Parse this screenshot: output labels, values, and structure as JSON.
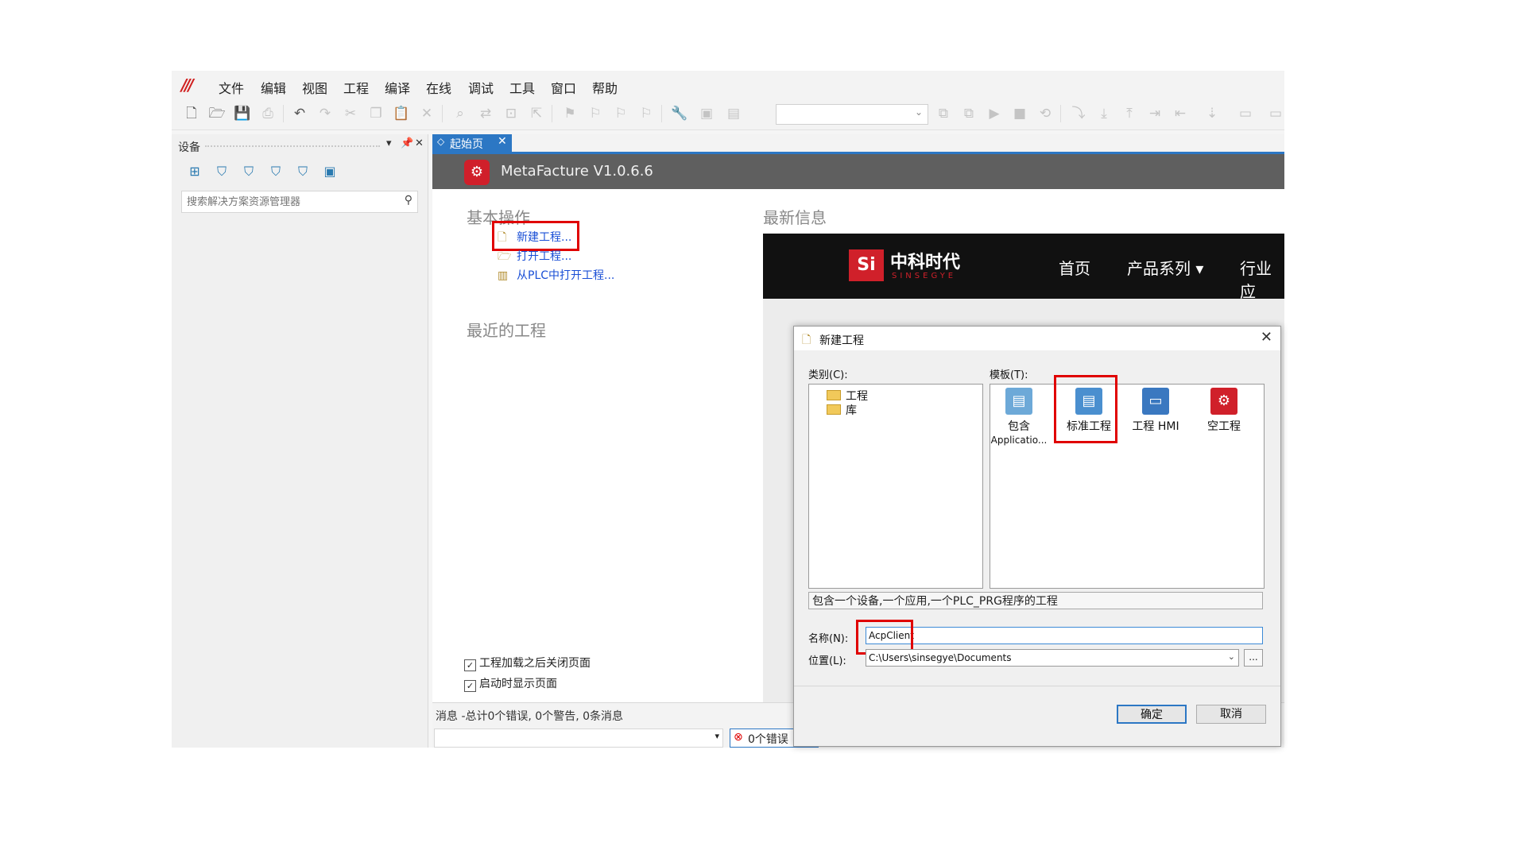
{
  "menubar": {
    "logo": "///",
    "items": [
      "文件",
      "编辑",
      "视图",
      "工程",
      "编译",
      "在线",
      "调试",
      "工具",
      "窗口",
      "帮助"
    ]
  },
  "toolbar": {
    "icons": [
      "new-file-icon",
      "open-folder-icon",
      "save-icon",
      "print-icon",
      "undo-icon",
      "redo-icon",
      "cut-icon",
      "copy-icon",
      "paste-icon",
      "delete-icon"
    ]
  },
  "left_panel": {
    "title": "设备",
    "search_placeholder": "搜索解决方案资源管理器"
  },
  "tabs": [
    {
      "label": "起始页"
    }
  ],
  "banner": {
    "title": "MetaFacture V1.0.6.6"
  },
  "basic_ops": {
    "heading": "基本操作",
    "new_project": "新建工程...",
    "open_project": "打开工程...",
    "open_from_plc": "从PLC中打开工程..."
  },
  "recent": {
    "heading": "最近的工程"
  },
  "news": {
    "heading": "最新信息",
    "brand": "中科时代",
    "brand_sub": "SINSEGYE",
    "nav": [
      "首页",
      "产品系列 ▾",
      "行业应"
    ]
  },
  "checkboxes": {
    "close_after_load": "工程加载之后关闭页面",
    "show_on_startup": "启动时显示页面"
  },
  "messages": {
    "title": "消息 -总计0个错误, 0个警告, 0条消息",
    "errors": "0个错误"
  },
  "dialog": {
    "title": "新建工程",
    "category_label": "类别(C):",
    "categories": [
      "工程",
      "库"
    ],
    "template_label": "模板(T):",
    "templates": [
      {
        "label": "包含",
        "sub": "Applicatio..."
      },
      {
        "label": "标准工程",
        "sub": ""
      },
      {
        "label": "工程 HMI",
        "sub": ""
      },
      {
        "label": "空工程",
        "sub": ""
      }
    ],
    "description": "包含一个设备,一个应用,一个PLC_PRG程序的工程",
    "name_label": "名称(N):",
    "name_value": "AcpClient",
    "location_label": "位置(L):",
    "location_value": "C:\\Users\\sinsegye\\Documents",
    "browse": "...",
    "ok": "确定",
    "cancel": "取消"
  },
  "colors": {
    "accent": "#2c77c4",
    "highlight": "#e00000",
    "brand_red": "#d0202a"
  }
}
